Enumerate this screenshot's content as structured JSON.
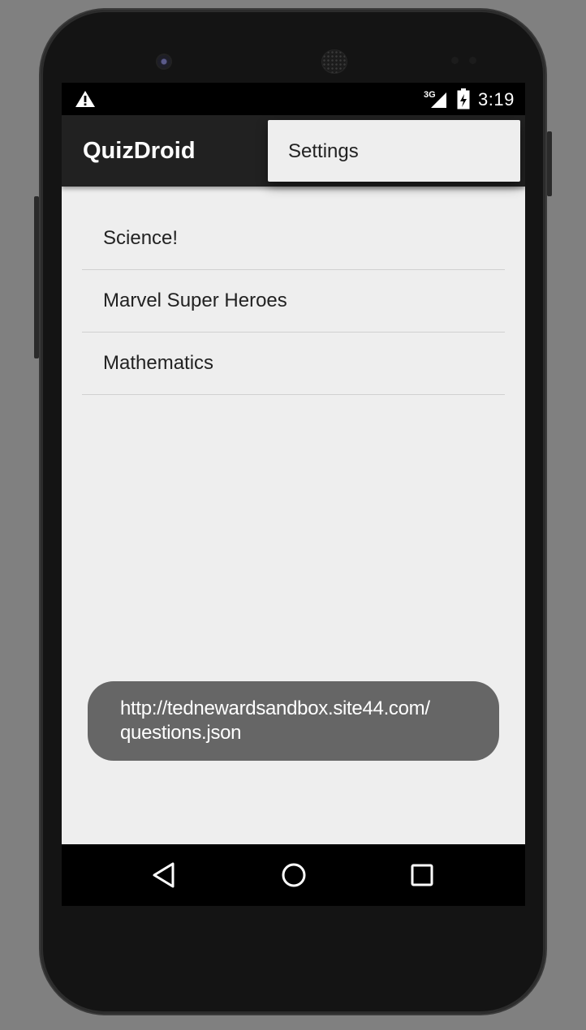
{
  "status_bar": {
    "warning_icon": "warning-triangle-icon",
    "network_label": "3G",
    "time": "3:19"
  },
  "action_bar": {
    "title": "QuizDroid"
  },
  "overflow_menu": {
    "items": [
      {
        "label": "Settings"
      }
    ]
  },
  "topics": [
    {
      "label": "Science!"
    },
    {
      "label": "Marvel Super Heroes"
    },
    {
      "label": "Mathematics"
    }
  ],
  "toast": {
    "line1": "http://tednewardsandbox.site44.com/",
    "line2": "questions.json"
  },
  "navigation": {
    "back_icon": "back-triangle-icon",
    "home_icon": "home-circle-icon",
    "recents_icon": "recents-square-icon"
  },
  "colors": {
    "action_bar": "#212121",
    "screen_background": "#eeeeee",
    "toast_background": "#666666",
    "status_bar": "#000000"
  }
}
